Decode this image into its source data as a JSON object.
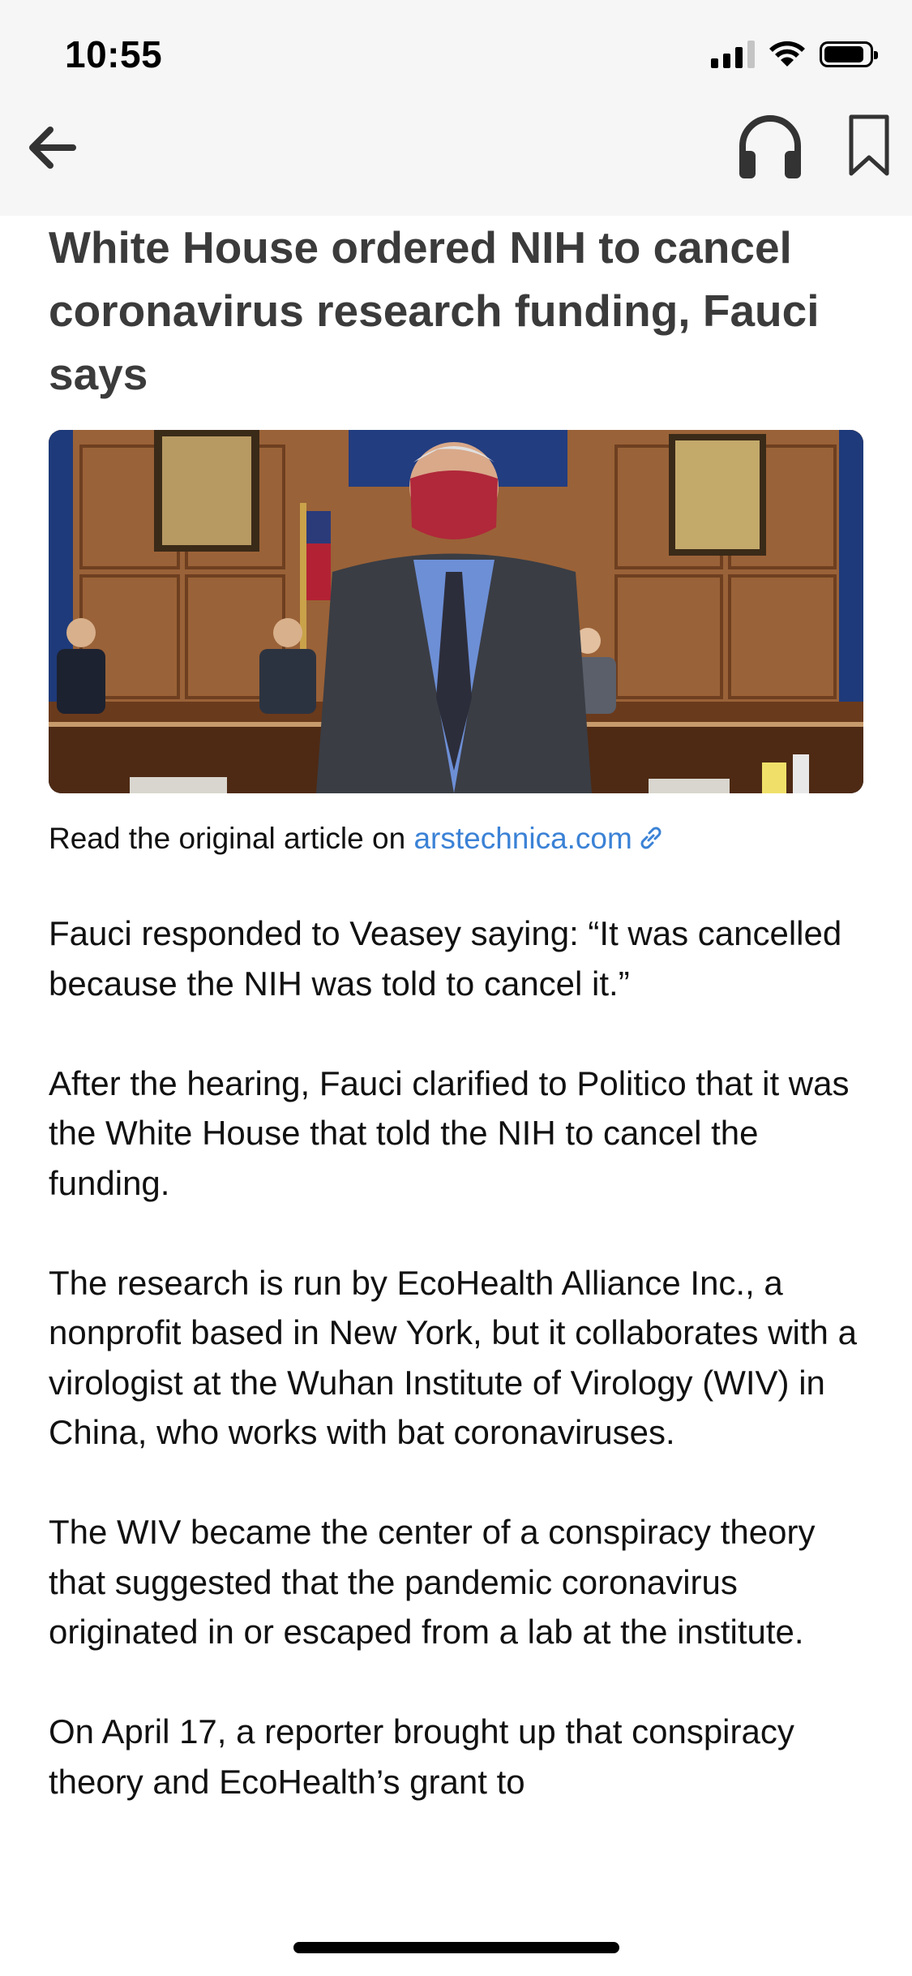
{
  "status_bar": {
    "time": "10:55"
  },
  "nav": {
    "back_icon": "arrow-left-icon",
    "audio_icon": "headphones-icon",
    "bookmark_icon": "bookmark-icon"
  },
  "article": {
    "title": "White House ordered NIH to cancel coronavirus research funding, Fauci says",
    "source_prefix": "Read the original article on ",
    "source_link": "arstechnica.com",
    "paragraphs": [
      "Fauci responded to Veasey saying: “It was cancelled because the NIH was told to cancel it.”",
      "After the hearing, Fauci clarified to Politico that it was the White House that told the NIH to cancel the funding.",
      "The research is run by EcoHealth Alliance Inc., a nonprofit based in New York, but it collaborates with a virologist at the Wuhan Institute of Virology (WIV) in China, who works with bat coronaviruses.",
      "The WIV became the center of a conspiracy theory that suggested that the pandemic coronavirus originated in or escaped from a lab at the institute.",
      "On April 17, a reporter brought up that conspiracy theory and EcoHealth’s grant to"
    ]
  },
  "colors": {
    "link": "#3b82d6",
    "title": "#3b3b3b",
    "topbar": "#f6f6f6"
  }
}
